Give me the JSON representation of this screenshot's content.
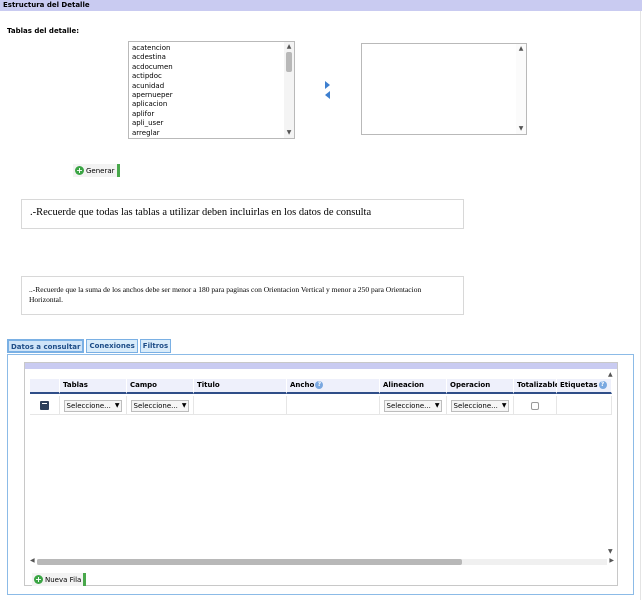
{
  "window": {
    "title": "Estructura del Detalle"
  },
  "section": {
    "label": "Tablas del detalle:"
  },
  "source_list": {
    "items": [
      "acatencion",
      "acdestina",
      "acdocumen",
      "actipdoc",
      "acunidad",
      "apernueper",
      "aplicacion",
      "aplifor",
      "apli_user",
      "arreglar"
    ]
  },
  "buttons": {
    "generar": "Generar",
    "nueva_fila": "Nueva Fila"
  },
  "notes": {
    "note1": ".-Recuerde que todas las tablas a utilizar deben incluirlas en los datos de consulta",
    "note2": "..-Recuerde que la suma de los anchos debe ser menor a 180 para paginas con Orientacion Vertical y menor a 250 para Orientacion Horizontal."
  },
  "tabs": [
    {
      "label": "Datos a consultar",
      "active": true
    },
    {
      "label": "Conexiones",
      "active": false
    },
    {
      "label": "Filtros",
      "active": false
    }
  ],
  "grid": {
    "columns": [
      "",
      "Tablas",
      "Campo",
      "Titulo",
      "Ancho",
      "Alineacion",
      "Operacion",
      "Totalizable",
      "Etiquetas"
    ],
    "row": {
      "tablas": "Seleccione...",
      "campo": "Seleccione...",
      "alineacion": "Seleccione...",
      "operacion": "Seleccione..."
    }
  },
  "colors": {
    "titlebar": "#c9cbf1",
    "tab_border": "#7ab0e4",
    "accent_green": "#3ba545",
    "header_underline": "#2f4e88"
  },
  "icons": [
    "chevron-right-icon",
    "chevron-left-icon",
    "add-icon",
    "help-icon",
    "delete-icon"
  ]
}
